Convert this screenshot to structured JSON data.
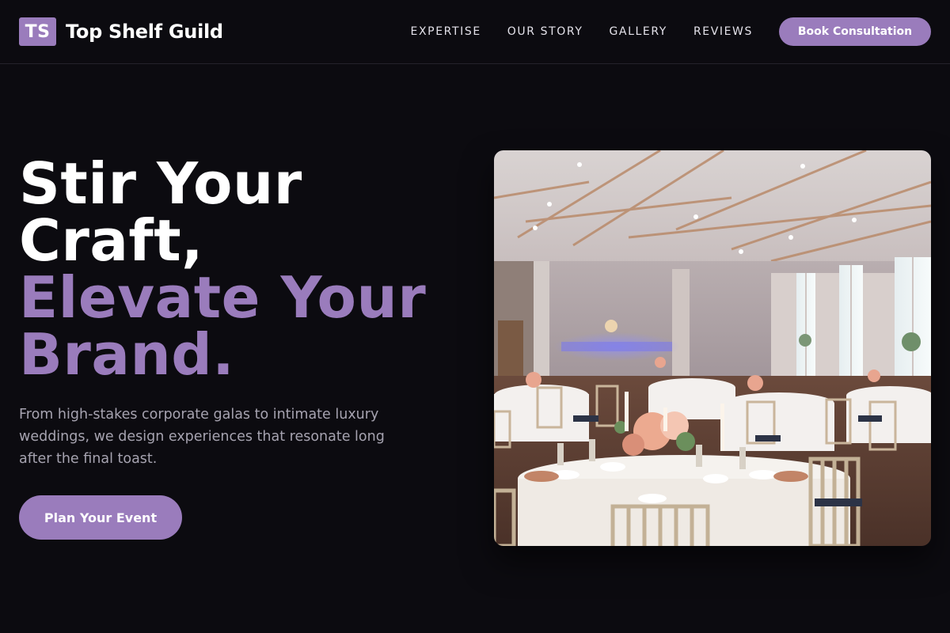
{
  "brand": {
    "logo_initials": "TS",
    "name": "Top Shelf Guild"
  },
  "nav": {
    "items": [
      "EXPERTISE",
      "OUR STORY",
      "GALLERY",
      "REVIEWS"
    ],
    "cta_label": "Book Consultation"
  },
  "hero": {
    "title_lines": [
      "Stir Your",
      "Craft,"
    ],
    "accent_lines": [
      "Elevate Your",
      "Brand."
    ],
    "subtitle": "From high-stakes corporate galas to intimate luxury weddings, we design experiences that resonate long after the final toast.",
    "cta_label": "Plan Your Event"
  },
  "colors": {
    "background": "#0c0b10",
    "accent": "#9a7cbc",
    "text": "#ffffff",
    "muted_text": "#a6a3b0"
  }
}
